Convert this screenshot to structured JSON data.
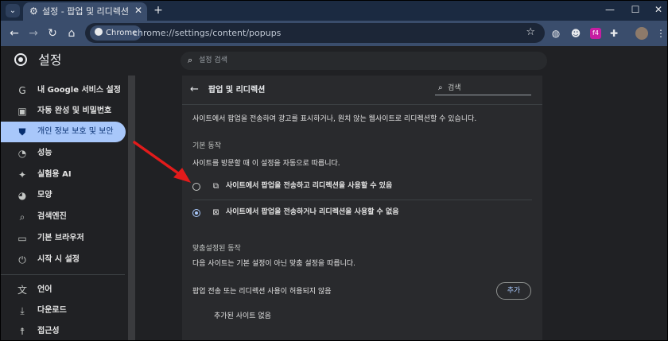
{
  "browser": {
    "tab_title": "설정 - 팝업 및 리디렉션",
    "new_tab": "+",
    "omnibox": {
      "chip_label": "Chrome",
      "url": "chrome://settings/content/popups"
    },
    "extension_badge": "f4"
  },
  "settings_header": {
    "title": "설정",
    "search_placeholder": "설정 검색"
  },
  "sidebar": {
    "items": [
      {
        "label": "내 Google 서비스 설정",
        "icon": "google-g-icon",
        "active": false
      },
      {
        "label": "자동 완성 및 비밀번호",
        "icon": "clipboard-icon",
        "active": false
      },
      {
        "label": "개인 정보 보호 및 보안",
        "icon": "shield-icon",
        "active": true
      },
      {
        "label": "성능",
        "icon": "speedometer-icon",
        "active": false
      },
      {
        "label": "실험용 AI",
        "icon": "sparkle-icon",
        "active": false
      },
      {
        "label": "모양",
        "icon": "palette-icon",
        "active": false
      },
      {
        "label": "검색엔진",
        "icon": "search-icon",
        "active": false
      },
      {
        "label": "기본 브라우저",
        "icon": "browser-window-icon",
        "active": false
      },
      {
        "label": "시작 시 설정",
        "icon": "power-icon",
        "active": false
      },
      {
        "label": "언어",
        "icon": "translate-icon",
        "active": false
      },
      {
        "label": "다운로드",
        "icon": "download-icon",
        "active": false
      },
      {
        "label": "접근성",
        "icon": "accessibility-icon",
        "active": false
      }
    ]
  },
  "content": {
    "title": "팝업 및 리디렉션",
    "search_placeholder": "검색",
    "description": "사이트에서 팝업을 전송하여 광고를 표시하거나, 원치 않는 웹사이트로 리디렉션할 수 있습니다.",
    "default_section": {
      "heading": "기본 동작",
      "subtitle": "사이트를 방문할 때 이 설정을 자동으로 따릅니다.",
      "options": [
        {
          "label": "사이트에서 팝업을 전송하고 리디렉션을 사용할 수 있음",
          "selected": false,
          "icon": "open-in-new-icon"
        },
        {
          "label": "사이트에서 팝업을 전송하거나 리디렉션을 사용할 수 없음",
          "selected": true,
          "icon": "blocked-popup-icon"
        }
      ]
    },
    "custom_section": {
      "heading": "맞춤설정된 동작",
      "subtitle": "다음 사이트는 기본 설정이 아닌 맞춤 설정을 따릅니다.",
      "blocked_label": "팝업 전송 또는 리디렉션 사용이 허용되지 않음",
      "add_button": "추가",
      "empty_text": "추가된 사이트 없음"
    }
  },
  "colors": {
    "tabstrip": "#1b2a41",
    "toolbar": "#3a4d6c",
    "page_bg": "#202124",
    "panel_bg": "#292a2d",
    "active_nav": "#a8c7fa",
    "annotation_arrow": "#e21b1b"
  }
}
